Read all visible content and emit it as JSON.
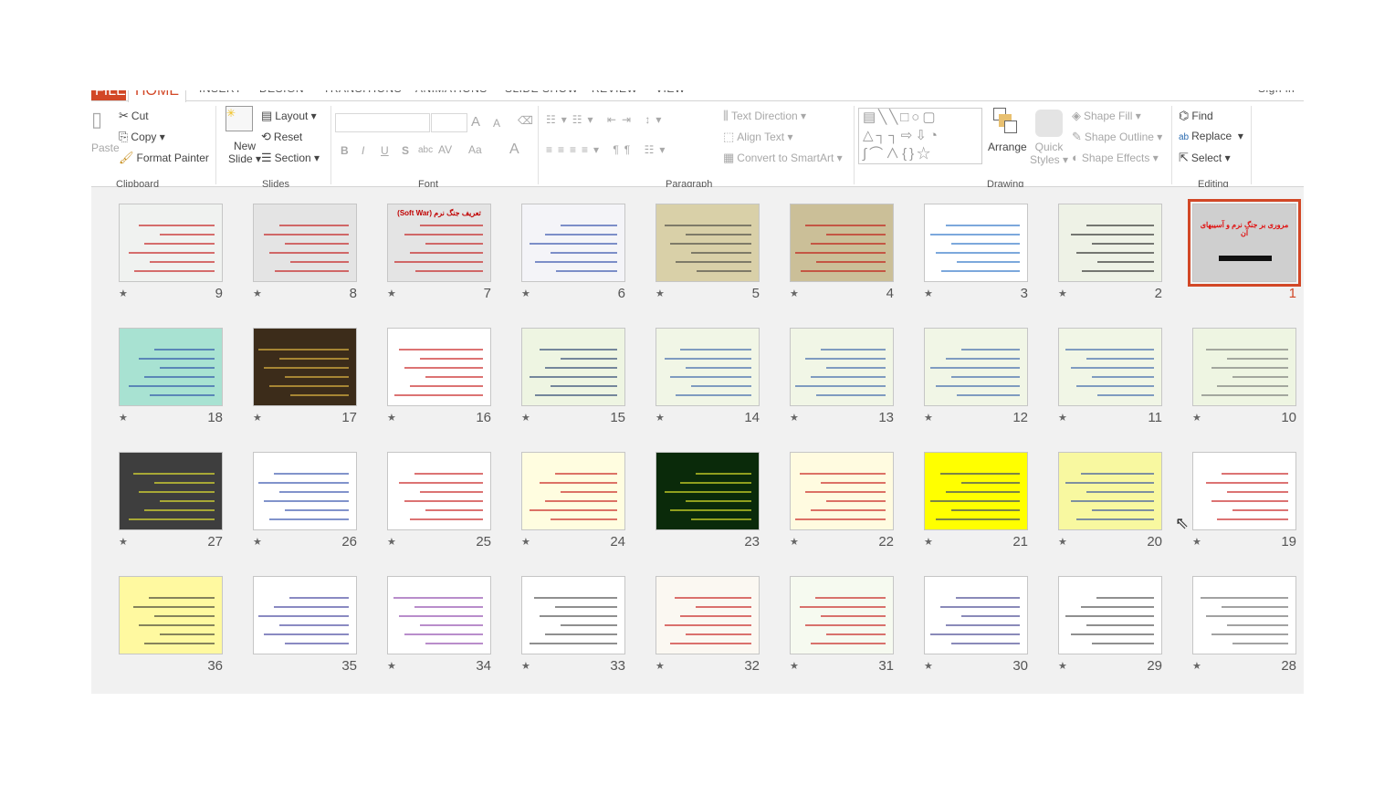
{
  "tabs": [
    "FILE",
    "HOME",
    "INSERT",
    "DESIGN",
    "TRANSITIONS",
    "ANIMATIONS",
    "SLIDE SHOW",
    "REVIEW",
    "VIEW"
  ],
  "sign_in": "Sign in",
  "clipboard": {
    "paste": "Paste",
    "cut": "Cut",
    "copy": "Copy",
    "format_painter": "Format Painter",
    "group": "Clipboard"
  },
  "slides_group": {
    "new_slide_1": "New",
    "new_slide_2": "Slide",
    "layout": "Layout",
    "reset": "Reset",
    "section": "Section",
    "group": "Slides"
  },
  "font": {
    "group": "Font",
    "bold": "B",
    "italic": "I",
    "underline": "U",
    "shadow": "S",
    "strike": "abc",
    "spacing": "AV",
    "case": "Aa",
    "color": "A",
    "grow": "A",
    "shrink": "A"
  },
  "paragraph": {
    "group": "Paragraph",
    "text_direction": "Text Direction",
    "align_text": "Align Text",
    "convert_smartart": "Convert to SmartArt"
  },
  "drawing": {
    "group": "Drawing",
    "arrange": "Arrange",
    "quick_styles_1": "Quick",
    "quick_styles_2": "Styles",
    "shape_fill": "Shape Fill",
    "shape_outline": "Shape Outline",
    "shape_effects": "Shape Effects"
  },
  "editing": {
    "group": "Editing",
    "find": "Find",
    "replace": "Replace",
    "select": "Select"
  },
  "accent": "#d24726",
  "slides": [
    {
      "n": 1,
      "star": false,
      "bg": "#cfcfcf",
      "fg": "#e01010",
      "title": "مروری بر جنگ نرم و آسیبهای آن",
      "selected": true
    },
    {
      "n": 2,
      "star": true,
      "bg": "#eef2e6",
      "fg": "#111",
      "title": ""
    },
    {
      "n": 3,
      "star": true,
      "bg": "#ffffff",
      "fg": "#1060c0",
      "title": ""
    },
    {
      "n": 4,
      "star": true,
      "bg": "#cbbf98",
      "fg": "#c00000",
      "title": ""
    },
    {
      "n": 5,
      "star": true,
      "bg": "#d9d0a8",
      "fg": "#333",
      "title": ""
    },
    {
      "n": 6,
      "star": true,
      "bg": "#f4f4f8",
      "fg": "#1a3aa0",
      "title": ""
    },
    {
      "n": 7,
      "star": true,
      "bg": "#e4e4e4",
      "fg": "#c00000",
      "title": "تعریف جنگ نرم (Soft War)"
    },
    {
      "n": 8,
      "star": true,
      "bg": "#e4e4e4",
      "fg": "#c00000",
      "title": ""
    },
    {
      "n": 9,
      "star": true,
      "bg": "#f0f2f0",
      "fg": "#c00000",
      "title": ""
    },
    {
      "n": 10,
      "star": true,
      "bg": "#eef5e2",
      "fg": "#666",
      "title": ""
    },
    {
      "n": 11,
      "star": true,
      "bg": "#f1f6e6",
      "fg": "#2050a0",
      "title": ""
    },
    {
      "n": 12,
      "star": true,
      "bg": "#f1f6e6",
      "fg": "#2050a0",
      "title": ""
    },
    {
      "n": 13,
      "star": true,
      "bg": "#f1f6e6",
      "fg": "#2050a0",
      "title": ""
    },
    {
      "n": 14,
      "star": true,
      "bg": "#f1f6e6",
      "fg": "#2050a0",
      "title": ""
    },
    {
      "n": 15,
      "star": true,
      "bg": "#eef5e2",
      "fg": "#102a60",
      "title": ""
    },
    {
      "n": 16,
      "star": true,
      "bg": "#ffffff",
      "fg": "#c00000",
      "title": ""
    },
    {
      "n": 17,
      "star": true,
      "bg": "#3c2c1a",
      "fg": "#ffd24a",
      "title": ""
    },
    {
      "n": 18,
      "star": true,
      "bg": "#a8e2d2",
      "fg": "#1a3aa0",
      "title": ""
    },
    {
      "n": 19,
      "star": true,
      "bg": "#ffffff",
      "fg": "#c00000",
      "title": ""
    },
    {
      "n": 20,
      "star": true,
      "bg": "#f8f8a0",
      "fg": "#1a3aa0",
      "title": ""
    },
    {
      "n": 21,
      "star": true,
      "bg": "#ffff00",
      "fg": "#102080",
      "title": ""
    },
    {
      "n": 22,
      "star": true,
      "bg": "#fffbe0",
      "fg": "#c00000",
      "title": ""
    },
    {
      "n": 23,
      "star": false,
      "bg": "#0a2a0a",
      "fg": "#ffff30",
      "title": ""
    },
    {
      "n": 24,
      "star": true,
      "bg": "#fffde0",
      "fg": "#c00000",
      "title": ""
    },
    {
      "n": 25,
      "star": true,
      "bg": "#ffffff",
      "fg": "#c00000",
      "title": ""
    },
    {
      "n": 26,
      "star": true,
      "bg": "#ffffff",
      "fg": "#1a3aa0",
      "title": ""
    },
    {
      "n": 27,
      "star": true,
      "bg": "#3e3e3e",
      "fg": "#ffff30",
      "title": ""
    },
    {
      "n": 28,
      "star": true,
      "bg": "#ffffff",
      "fg": "#555",
      "title": ""
    },
    {
      "n": 29,
      "star": true,
      "bg": "#ffffff",
      "fg": "#333",
      "title": ""
    },
    {
      "n": 30,
      "star": true,
      "bg": "#ffffff",
      "fg": "#2a2a80",
      "title": ""
    },
    {
      "n": 31,
      "star": true,
      "bg": "#f6faf0",
      "fg": "#c00000",
      "title": ""
    },
    {
      "n": 32,
      "star": true,
      "bg": "#fbf8f2",
      "fg": "#c00000",
      "title": ""
    },
    {
      "n": 33,
      "star": true,
      "bg": "#ffffff",
      "fg": "#333",
      "title": ""
    },
    {
      "n": 34,
      "star": true,
      "bg": "#ffffff",
      "fg": "#8030a0",
      "title": ""
    },
    {
      "n": 35,
      "star": false,
      "bg": "#ffffff",
      "fg": "#2a2a90",
      "title": ""
    },
    {
      "n": 36,
      "star": false,
      "bg": "#fff9a0",
      "fg": "#222",
      "title": ""
    }
  ]
}
